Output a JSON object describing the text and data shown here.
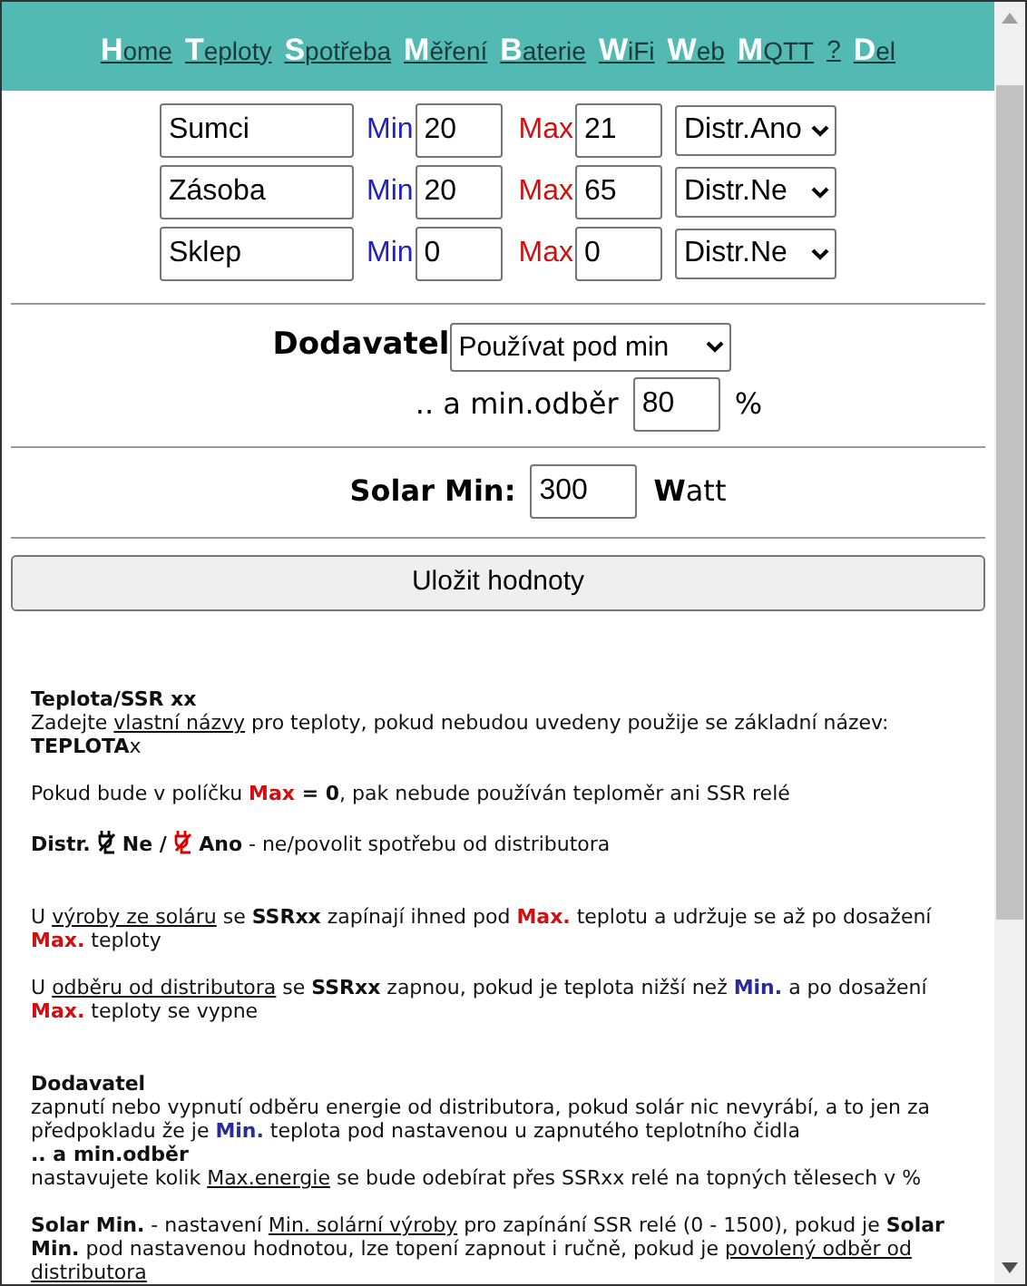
{
  "nav": [
    {
      "initial": "H",
      "rest": "ome"
    },
    {
      "initial": "T",
      "rest": "eploty"
    },
    {
      "initial": "S",
      "rest": "potřeba"
    },
    {
      "initial": "M",
      "rest": "ěření"
    },
    {
      "initial": "B",
      "rest": "aterie"
    },
    {
      "initial": "W",
      "rest": "iFi"
    },
    {
      "initial": "W",
      "rest": "eb"
    },
    {
      "initial": "M",
      "rest": "QTT"
    },
    {
      "rest": "?"
    },
    {
      "initial": "D",
      "rest": "el"
    }
  ],
  "sensors": [
    {
      "name": "Sumci",
      "min_label": "Min",
      "min": "20",
      "max_label": "Max",
      "max": "21",
      "distr": "Distr.Ano"
    },
    {
      "name": "Zásoba",
      "min_label": "Min",
      "min": "20",
      "max_label": "Max",
      "max": "65",
      "distr": "Distr.Ne"
    },
    {
      "name": "Sklep",
      "min_label": "Min",
      "min": "0",
      "max_label": "Max",
      "max": "0",
      "distr": "Distr.Ne"
    }
  ],
  "supplier": {
    "label": "Dodavatel",
    "mode": "Používat pod min",
    "min_label": ".. a min.odběr",
    "min_value": "80",
    "unit": "%"
  },
  "solar": {
    "label": "Solar Min:",
    "value": "300",
    "unit_initial": "W",
    "unit_rest": "att"
  },
  "save_button": "Uložit hodnoty",
  "help": [
    [
      {
        "lines": [
          [
            {
              "kind": "b",
              "text": "Teplota/SSR xx"
            }
          ],
          [
            {
              "kind": "t",
              "text": "Zadejte "
            },
            {
              "kind": "u",
              "text": "vlastní názvy"
            },
            {
              "kind": "t",
              "text": " pro teploty, pokud nebudou uvedeny použije se základní název: "
            },
            {
              "kind": "b",
              "text": "TEPLOTA"
            },
            {
              "kind": "t",
              "text": "x"
            }
          ]
        ]
      },
      {
        "lines": [
          [
            {
              "kind": "t",
              "text": "Pokud bude v políčku "
            },
            {
              "kind": "red",
              "text": "Max"
            },
            {
              "kind": "b",
              "text": " = 0"
            },
            {
              "kind": "t",
              "text": ", pak nebude používán teploměr ani SSR relé"
            }
          ]
        ]
      },
      {
        "lines": [
          [
            {
              "kind": "b",
              "text": "Distr. "
            },
            {
              "kind": "icon",
              "color": "#000000"
            },
            {
              "kind": "b",
              "text": " Ne / "
            },
            {
              "kind": "icon",
              "color": "#dd0000"
            },
            {
              "kind": "b",
              "text": " Ano"
            },
            {
              "kind": "t",
              "text": " - ne/povolit spotřebu od distributora"
            }
          ]
        ]
      }
    ],
    [
      {
        "lines": [
          [
            {
              "kind": "t",
              "text": "U "
            },
            {
              "kind": "u",
              "text": "výroby ze soláru"
            },
            {
              "kind": "t",
              "text": " se "
            },
            {
              "kind": "b",
              "text": "SSRxx"
            },
            {
              "kind": "t",
              "text": " zapínají ihned pod "
            },
            {
              "kind": "red",
              "text": "Max."
            },
            {
              "kind": "t",
              "text": " teplotu a udržuje se až po dosažení "
            },
            {
              "kind": "red",
              "text": "Max."
            },
            {
              "kind": "t",
              "text": " teploty"
            }
          ]
        ]
      },
      {
        "lines": [
          [
            {
              "kind": "t",
              "text": "U "
            },
            {
              "kind": "u",
              "text": "odběru od distributora"
            },
            {
              "kind": "t",
              "text": " se "
            },
            {
              "kind": "b",
              "text": "SSRxx"
            },
            {
              "kind": "t",
              "text": " zapnou, pokud je teplota nižší než "
            },
            {
              "kind": "blue",
              "text": "Min."
            },
            {
              "kind": "t",
              "text": " a po dosažení "
            },
            {
              "kind": "red",
              "text": "Max."
            },
            {
              "kind": "t",
              "text": " teploty se vypne"
            }
          ]
        ]
      }
    ],
    [
      {
        "lines": [
          [
            {
              "kind": "b",
              "text": "Dodavatel"
            }
          ],
          [
            {
              "kind": "t",
              "text": "zapnutí nebo vypnutí odběru energie od distributora, pokud solár nic nevyrábí, a to jen za předpokladu že je "
            },
            {
              "kind": "blue",
              "text": "Min."
            },
            {
              "kind": "t",
              "text": " teplota pod nastavenou u zapnutého teplotního čidla"
            }
          ],
          [
            {
              "kind": "b",
              "text": ".. a min.odběr"
            }
          ],
          [
            {
              "kind": "t",
              "text": "nastavujete kolik "
            },
            {
              "kind": "u",
              "text": "Max.energie"
            },
            {
              "kind": "t",
              "text": " se bude odebírat přes SSRxx relé na topných tělesech v %"
            }
          ]
        ]
      },
      {
        "lines": [
          [
            {
              "kind": "b",
              "text": "Solar Min."
            },
            {
              "kind": "t",
              "text": " - nastavení "
            },
            {
              "kind": "u",
              "text": "Min. solární výroby"
            },
            {
              "kind": "t",
              "text": " pro zapínání SSR relé (0 - 1500), pokud je "
            },
            {
              "kind": "b",
              "text": "Solar Min."
            },
            {
              "kind": "t",
              "text": " pod nastavenou hodnotou, lze topení zapnout i ručně, pokud je "
            },
            {
              "kind": "u",
              "text": "povolený odběr od distributora"
            }
          ]
        ]
      }
    ]
  ]
}
